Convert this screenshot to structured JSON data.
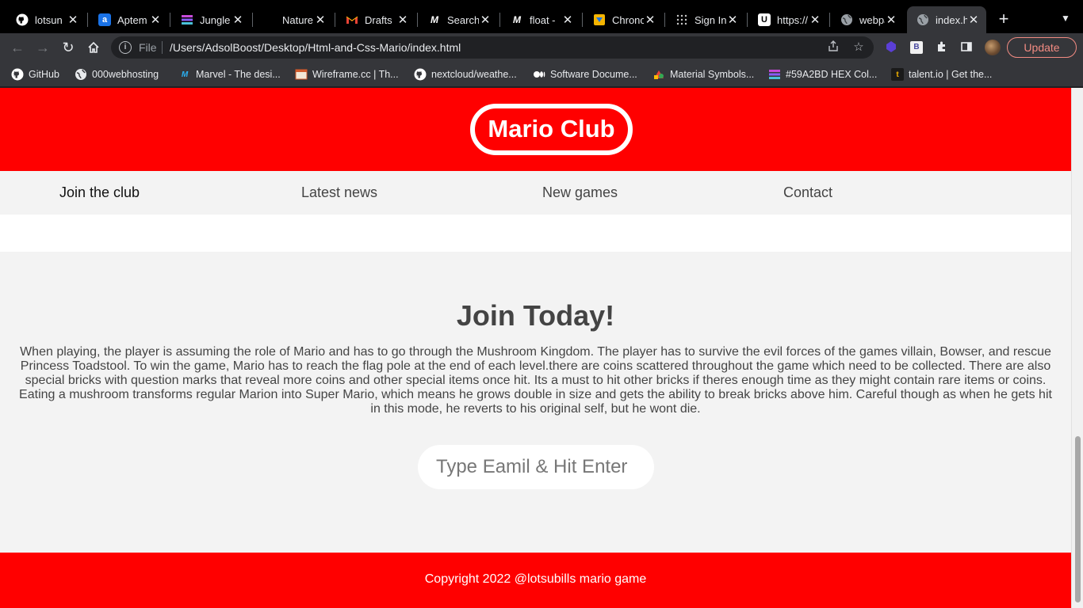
{
  "browser": {
    "tabs": [
      {
        "title": "lotsun",
        "icon": "github-icon"
      },
      {
        "title": "Aptem",
        "icon": "aptem-icon"
      },
      {
        "title": "Jungle",
        "icon": "jungle-icon"
      },
      {
        "title": "Nature",
        "icon": "blank-icon"
      },
      {
        "title": "Drafts",
        "icon": "gmail-icon"
      },
      {
        "title": "Search",
        "icon": "m-icon"
      },
      {
        "title": "float -",
        "icon": "m-icon"
      },
      {
        "title": "Chrono",
        "icon": "chrono-icon"
      },
      {
        "title": "Sign In",
        "icon": "dots-icon"
      },
      {
        "title": "https://",
        "icon": "u-icon"
      },
      {
        "title": "webpa",
        "icon": "globe-icon"
      },
      {
        "title": "index.h",
        "icon": "globe-icon",
        "active": true
      }
    ],
    "address": {
      "scheme_label": "File",
      "url": "/Users/AdsolBoost/Desktop/Html-and-Css-Mario/index.html"
    },
    "update_label": "Update",
    "bookmarks": [
      {
        "label": "GitHub"
      },
      {
        "label": "000webhosting"
      },
      {
        "label": "Marvel - The desi..."
      },
      {
        "label": "Wireframe.cc | Th..."
      },
      {
        "label": "nextcloud/weathe..."
      },
      {
        "label": "Software Docume..."
      },
      {
        "label": "Material Symbols..."
      },
      {
        "label": "#59A2BD HEX Col..."
      },
      {
        "label": "talent.io | Get the..."
      }
    ]
  },
  "site": {
    "logo": "Mario Club",
    "nav": [
      "Join the club",
      "Latest news",
      "New games",
      "Contact"
    ],
    "join": {
      "heading": "Join Today!",
      "body": "When playing, the player is assuming the role of Mario and has to go through the Mushroom Kingdom. The player has to survive the evil forces of the games villain, Bowser, and rescue Princess Toadstool. To win the game, Mario has to reach the flag pole at the end of each level.there are coins scattered throughout the game which need to be collected. There are also special bricks with question marks that reveal more coins and other special items once hit. Its a must to hit other bricks if theres enough time as they might contain rare items or coins. Eating a mushroom transforms regular Marion into Super Mario, which means he grows double in size and gets the ability to break bricks above him. Careful though as when he gets hit in this mode, he reverts to his original self, but he wont die.",
      "email_placeholder": "Type Eamil & Hit Enter"
    },
    "footer": "Copyright 2022 @lotsubills mario game"
  },
  "colors": {
    "brand_red": "#ff0000",
    "section_gray": "#f3f3f3",
    "text_dark": "#444444"
  }
}
